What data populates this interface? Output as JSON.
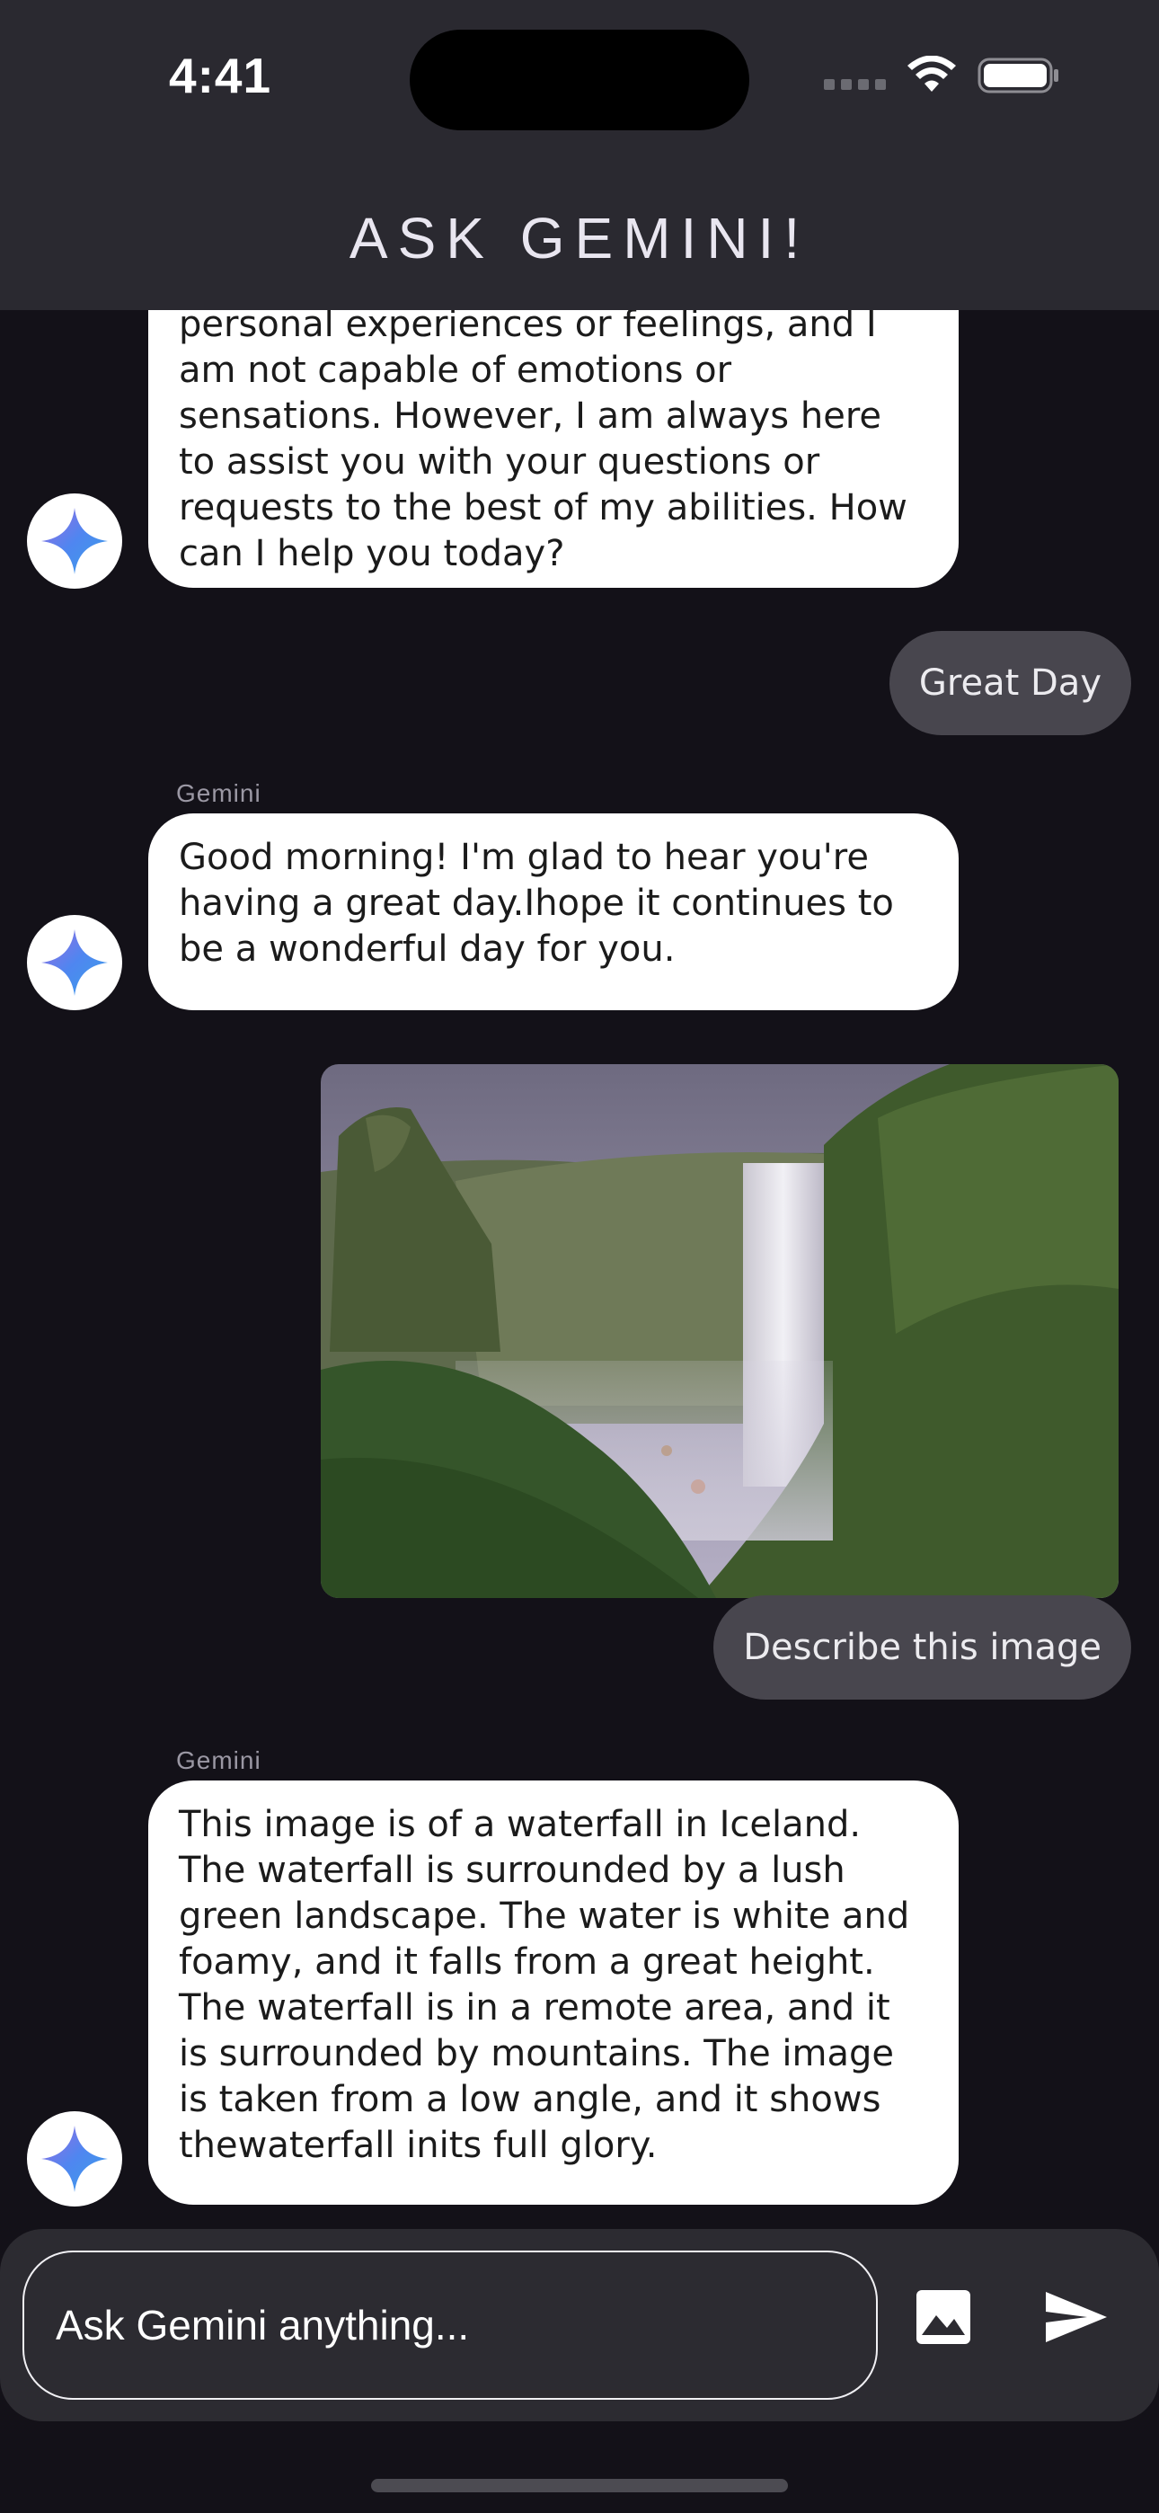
{
  "status_bar": {
    "time": "4:41"
  },
  "header": {
    "title": "ASK GEMINI!"
  },
  "messages": [
    {
      "role": "bot",
      "sender": "",
      "text": "personal experiences or feelings, and I am not capable of emotions or sensations. However, I am always here to assist you with your questions or requests to the best of my abilities. How can I help you today?"
    },
    {
      "role": "user",
      "text": "Great Day"
    },
    {
      "role": "bot",
      "sender": "Gemini",
      "text": "Good morning! I'm glad to hear you're having a great day.Ihope it continues to be a wonderful day for you."
    },
    {
      "role": "user",
      "image": "waterfall photo",
      "text": "Describe this image"
    },
    {
      "role": "bot",
      "sender": "Gemini",
      "text": " This image is of a waterfall in Iceland. The waterfall is surrounded by a lush green landscape. The water is white and foamy, and it falls from a great height. The waterfall is in a remote area, and it is surrounded by mountains. The image is taken from a low angle, and it shows thewaterfall inits full glory."
    }
  ],
  "input": {
    "placeholder": "Ask Gemini anything..."
  },
  "icons": {
    "attach": "image-icon",
    "send": "send-icon",
    "avatar": "gemini-sparkle-icon"
  },
  "colors": {
    "background": "#131118",
    "header": "#2a2930",
    "user_bubble": "#48464e",
    "bot_bubble": "#ffffff"
  }
}
